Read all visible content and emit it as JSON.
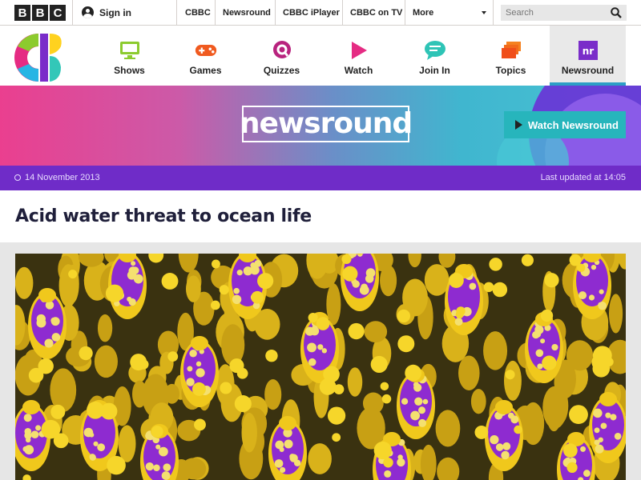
{
  "bbc_bar": {
    "logo_letters": [
      "B",
      "B",
      "C"
    ],
    "sign_in": "Sign in",
    "links": [
      "CBBC",
      "Newsround",
      "CBBC iPlayer",
      "CBBC on TV",
      "More"
    ],
    "search_placeholder": "Search"
  },
  "nav": {
    "items": [
      {
        "label": "Shows",
        "icon": "monitor-icon"
      },
      {
        "label": "Games",
        "icon": "gamepad-icon"
      },
      {
        "label": "Quizzes",
        "icon": "quiz-icon"
      },
      {
        "label": "Watch",
        "icon": "play-icon"
      },
      {
        "label": "Join In",
        "icon": "chat-bubble-icon"
      },
      {
        "label": "Topics",
        "icon": "folders-icon"
      },
      {
        "label": "Newsround",
        "icon": "newsround-icon",
        "active": true
      }
    ]
  },
  "banner": {
    "logo_text": "newsround",
    "watch_button": "Watch Newsround"
  },
  "article": {
    "date": "14 November 2013",
    "last_updated": "Last updated at 14:05",
    "headline": "Acid water threat to ocean life"
  },
  "colors": {
    "date_bar": "#6f2cc8",
    "watch_button": "#27b5bc",
    "active_tab_underline": "#2d9ec6",
    "coral_yellow": "#f0c81c",
    "coral_purple": "#8e2bd0"
  }
}
